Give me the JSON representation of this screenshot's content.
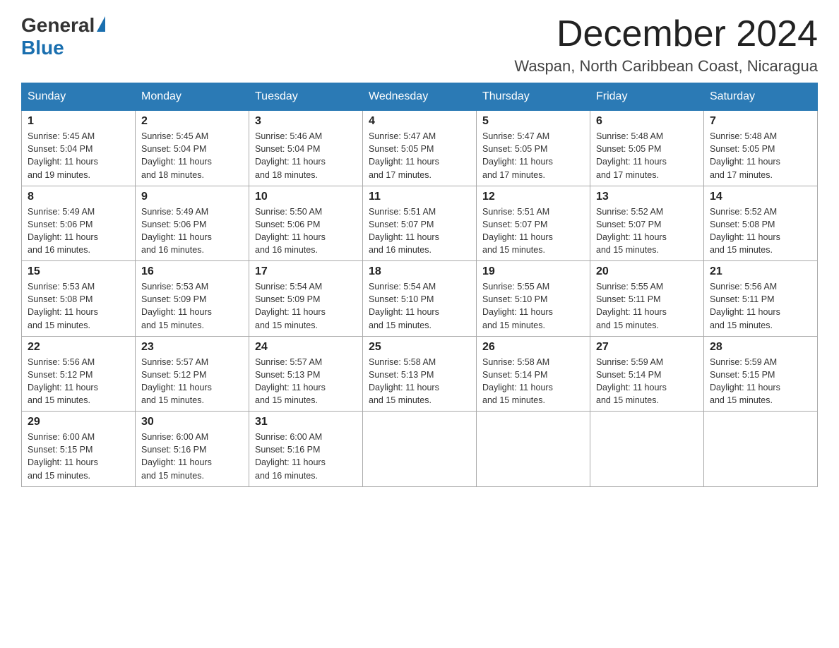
{
  "logo": {
    "general": "General",
    "blue": "Blue",
    "triangle": "▶"
  },
  "title": "December 2024",
  "location": "Waspan, North Caribbean Coast, Nicaragua",
  "days_of_week": [
    "Sunday",
    "Monday",
    "Tuesday",
    "Wednesday",
    "Thursday",
    "Friday",
    "Saturday"
  ],
  "weeks": [
    [
      {
        "day": "1",
        "sunrise": "5:45 AM",
        "sunset": "5:04 PM",
        "daylight": "11 hours and 19 minutes."
      },
      {
        "day": "2",
        "sunrise": "5:45 AM",
        "sunset": "5:04 PM",
        "daylight": "11 hours and 18 minutes."
      },
      {
        "day": "3",
        "sunrise": "5:46 AM",
        "sunset": "5:04 PM",
        "daylight": "11 hours and 18 minutes."
      },
      {
        "day": "4",
        "sunrise": "5:47 AM",
        "sunset": "5:05 PM",
        "daylight": "11 hours and 17 minutes."
      },
      {
        "day": "5",
        "sunrise": "5:47 AM",
        "sunset": "5:05 PM",
        "daylight": "11 hours and 17 minutes."
      },
      {
        "day": "6",
        "sunrise": "5:48 AM",
        "sunset": "5:05 PM",
        "daylight": "11 hours and 17 minutes."
      },
      {
        "day": "7",
        "sunrise": "5:48 AM",
        "sunset": "5:05 PM",
        "daylight": "11 hours and 17 minutes."
      }
    ],
    [
      {
        "day": "8",
        "sunrise": "5:49 AM",
        "sunset": "5:06 PM",
        "daylight": "11 hours and 16 minutes."
      },
      {
        "day": "9",
        "sunrise": "5:49 AM",
        "sunset": "5:06 PM",
        "daylight": "11 hours and 16 minutes."
      },
      {
        "day": "10",
        "sunrise": "5:50 AM",
        "sunset": "5:06 PM",
        "daylight": "11 hours and 16 minutes."
      },
      {
        "day": "11",
        "sunrise": "5:51 AM",
        "sunset": "5:07 PM",
        "daylight": "11 hours and 16 minutes."
      },
      {
        "day": "12",
        "sunrise": "5:51 AM",
        "sunset": "5:07 PM",
        "daylight": "11 hours and 15 minutes."
      },
      {
        "day": "13",
        "sunrise": "5:52 AM",
        "sunset": "5:07 PM",
        "daylight": "11 hours and 15 minutes."
      },
      {
        "day": "14",
        "sunrise": "5:52 AM",
        "sunset": "5:08 PM",
        "daylight": "11 hours and 15 minutes."
      }
    ],
    [
      {
        "day": "15",
        "sunrise": "5:53 AM",
        "sunset": "5:08 PM",
        "daylight": "11 hours and 15 minutes."
      },
      {
        "day": "16",
        "sunrise": "5:53 AM",
        "sunset": "5:09 PM",
        "daylight": "11 hours and 15 minutes."
      },
      {
        "day": "17",
        "sunrise": "5:54 AM",
        "sunset": "5:09 PM",
        "daylight": "11 hours and 15 minutes."
      },
      {
        "day": "18",
        "sunrise": "5:54 AM",
        "sunset": "5:10 PM",
        "daylight": "11 hours and 15 minutes."
      },
      {
        "day": "19",
        "sunrise": "5:55 AM",
        "sunset": "5:10 PM",
        "daylight": "11 hours and 15 minutes."
      },
      {
        "day": "20",
        "sunrise": "5:55 AM",
        "sunset": "5:11 PM",
        "daylight": "11 hours and 15 minutes."
      },
      {
        "day": "21",
        "sunrise": "5:56 AM",
        "sunset": "5:11 PM",
        "daylight": "11 hours and 15 minutes."
      }
    ],
    [
      {
        "day": "22",
        "sunrise": "5:56 AM",
        "sunset": "5:12 PM",
        "daylight": "11 hours and 15 minutes."
      },
      {
        "day": "23",
        "sunrise": "5:57 AM",
        "sunset": "5:12 PM",
        "daylight": "11 hours and 15 minutes."
      },
      {
        "day": "24",
        "sunrise": "5:57 AM",
        "sunset": "5:13 PM",
        "daylight": "11 hours and 15 minutes."
      },
      {
        "day": "25",
        "sunrise": "5:58 AM",
        "sunset": "5:13 PM",
        "daylight": "11 hours and 15 minutes."
      },
      {
        "day": "26",
        "sunrise": "5:58 AM",
        "sunset": "5:14 PM",
        "daylight": "11 hours and 15 minutes."
      },
      {
        "day": "27",
        "sunrise": "5:59 AM",
        "sunset": "5:14 PM",
        "daylight": "11 hours and 15 minutes."
      },
      {
        "day": "28",
        "sunrise": "5:59 AM",
        "sunset": "5:15 PM",
        "daylight": "11 hours and 15 minutes."
      }
    ],
    [
      {
        "day": "29",
        "sunrise": "6:00 AM",
        "sunset": "5:15 PM",
        "daylight": "11 hours and 15 minutes."
      },
      {
        "day": "30",
        "sunrise": "6:00 AM",
        "sunset": "5:16 PM",
        "daylight": "11 hours and 15 minutes."
      },
      {
        "day": "31",
        "sunrise": "6:00 AM",
        "sunset": "5:16 PM",
        "daylight": "11 hours and 16 minutes."
      },
      null,
      null,
      null,
      null
    ]
  ],
  "labels": {
    "sunrise": "Sunrise:",
    "sunset": "Sunset:",
    "daylight": "Daylight:"
  }
}
